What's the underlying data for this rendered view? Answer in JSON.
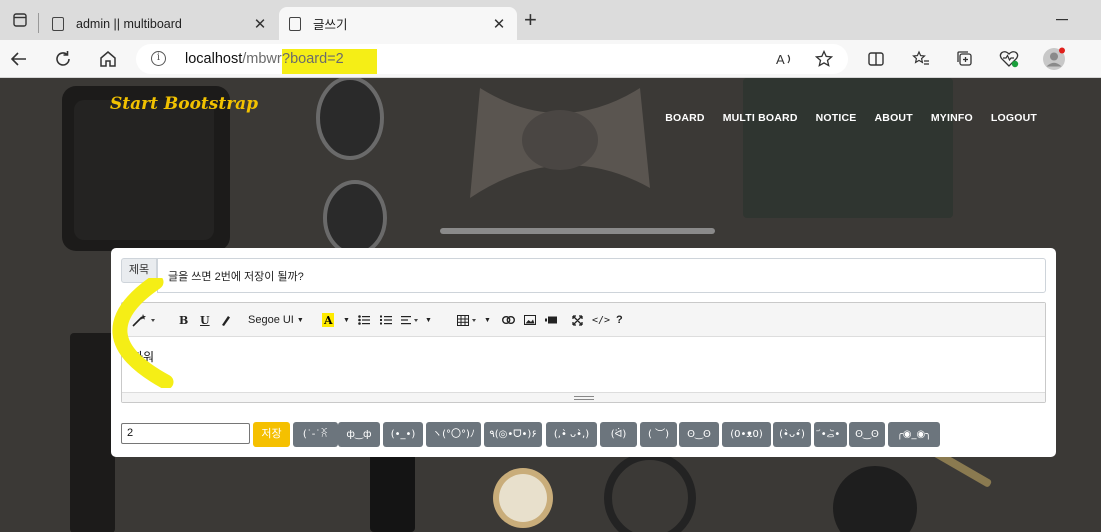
{
  "browser": {
    "tabs": [
      {
        "title": "admin || multiboard",
        "active": false
      },
      {
        "title": "글쓰기",
        "active": true
      }
    ],
    "address": {
      "host": "localhost",
      "path": "/mbwrite",
      "query": "?board=2"
    },
    "colors": {
      "highlight": "#f5ee16"
    }
  },
  "site": {
    "brand": "Start Bootstrap",
    "nav": [
      "BOARD",
      "MULTI BOARD",
      "NOTICE",
      "ABOUT",
      "MYINFO",
      "LOGOUT"
    ],
    "brand_color": "#f2c200"
  },
  "form": {
    "title_label": "제목",
    "title_value": "글을 쓰면 2번에 저장이 될까?",
    "editor": {
      "font_name": "Segoe UI",
      "content": "과워"
    },
    "board_value": "2",
    "save_label": "저장",
    "emoticons": [
      "(˙-˙ꐦ",
      "ф‿ф",
      "(•_•)",
      "ヽ(°〇°)ﾉ",
      "٩(◎•ᗜ•)۶",
      "(,•̀ ᴗ•̀,)",
      "(ᐛ⁠)",
      "( ︶)",
      "ʘ‿ʘ",
      "(0•ᴥ0)",
      "(•̀ᴗ•́)",
      "•᷄‎ࡇ•᷅",
      "ʘ‿ʘ",
      "╭◉_◉╮"
    ],
    "colors": {
      "save": "#f5c000",
      "emoticon_bg": "#6c757d"
    }
  }
}
